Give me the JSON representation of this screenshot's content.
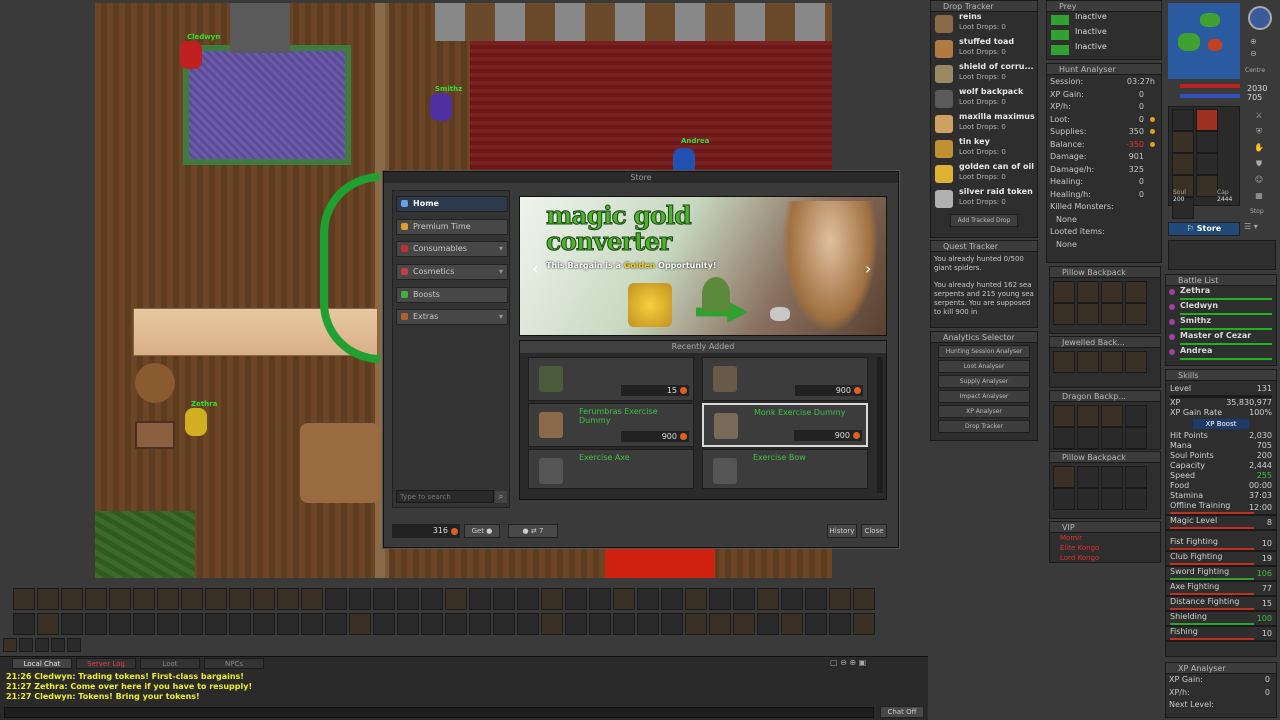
{
  "map": {
    "characters": [
      {
        "name": "Cledwyn"
      },
      {
        "name": "Smithz"
      },
      {
        "name": "Andrea"
      },
      {
        "name": "Zethra"
      }
    ]
  },
  "store": {
    "title": "Store",
    "categories": [
      {
        "label": "Home",
        "has_arrow": false
      },
      {
        "label": "Premium Time",
        "has_arrow": false
      },
      {
        "label": "Consumables",
        "has_arrow": true
      },
      {
        "label": "Cosmetics",
        "has_arrow": true
      },
      {
        "label": "Boosts",
        "has_arrow": false
      },
      {
        "label": "Extras",
        "has_arrow": true
      }
    ],
    "search_placeholder": "Type to search",
    "banner": {
      "title_line1": "magic gold",
      "title_line2": "converter",
      "subtitle_pre": "This Bargain is a ",
      "subtitle_highlight": "Golden",
      "subtitle_post": " Opportunity!"
    },
    "recently_added_label": "Recently Added",
    "items": [
      {
        "name": "",
        "price": "15"
      },
      {
        "name": "",
        "price": "900"
      },
      {
        "name": "Ferumbras Exercise Dummy",
        "price": "900"
      },
      {
        "name": "Monk Exercise Dummy",
        "price": "900"
      },
      {
        "name": "Exercise Axe",
        "price": ""
      },
      {
        "name": "Exercise Bow",
        "price": ""
      }
    ],
    "coins": "316",
    "get_label": "Get",
    "transfer_value": "7",
    "history_label": "History",
    "close_label": "Close"
  },
  "drop_tracker": {
    "title": "Drop Tracker",
    "items": [
      {
        "name": "reins",
        "drops": "Loot Drops: 0"
      },
      {
        "name": "stuffed toad",
        "drops": "Loot Drops: 0"
      },
      {
        "name": "shield of corru...",
        "drops": "Loot Drops: 0"
      },
      {
        "name": "wolf backpack",
        "drops": "Loot Drops: 0"
      },
      {
        "name": "maxilla maximus",
        "drops": "Loot Drops: 0"
      },
      {
        "name": "tin key",
        "drops": "Loot Drops: 0"
      },
      {
        "name": "golden can of oil",
        "drops": "Loot Drops: 0"
      },
      {
        "name": "silver raid token",
        "drops": "Loot Drops: 0"
      }
    ],
    "add_label": "Add Tracked Drop"
  },
  "quest_tracker": {
    "title": "Quest Tracker",
    "lines": [
      "You already hunted 0/500 giant spiders.",
      "You already hunted 162 sea serpents and 215 young sea serpents. You are supposed to kill 900 in"
    ]
  },
  "analytics": {
    "title": "Analytics Selector",
    "buttons": [
      "Hunting Session Analyser",
      "Loot Analyser",
      "Supply Analyser",
      "Impact Analyser",
      "XP Analyser",
      "Drop Tracker"
    ]
  },
  "prey": {
    "title": "Prey",
    "slots": [
      "Inactive",
      "Inactive",
      "Inactive"
    ]
  },
  "hunt_analyser": {
    "title": "Hunt Analyser",
    "rows": [
      {
        "k": "Session:",
        "v": "03:27h"
      },
      {
        "k": "XP Gain:",
        "v": "0"
      },
      {
        "k": "XP/h:",
        "v": "0"
      },
      {
        "k": "Loot:",
        "v": "0"
      },
      {
        "k": "Supplies:",
        "v": "350"
      },
      {
        "k": "Balance:",
        "v": "-350"
      },
      {
        "k": "Damage:",
        "v": "901"
      },
      {
        "k": "Damage/h:",
        "v": "325"
      },
      {
        "k": "Healing:",
        "v": "0"
      },
      {
        "k": "Healing/h:",
        "v": "0"
      }
    ],
    "killed_label": "Killed Monsters:",
    "killed_value": "None",
    "looted_label": "Looted items:",
    "looted_value": "None"
  },
  "containers": [
    {
      "title": "Pillow Backpack"
    },
    {
      "title": "Jewelled Back..."
    },
    {
      "title": "Dragon Backp..."
    },
    {
      "title": "Pillow Backpack"
    }
  ],
  "vip": {
    "title": "VIP",
    "names": [
      "Momir",
      "Elite Kongo",
      "Lord Kongo"
    ]
  },
  "status": {
    "hp": "2030",
    "mana": "705",
    "soul": "200",
    "cap": "2444",
    "soul_label": "Soul",
    "cap_label": "Cap",
    "store_label": "Store",
    "stop_label": "Stop",
    "centre_label": "Centre"
  },
  "battle_list": {
    "title": "Battle List",
    "names": [
      "Zethra",
      "Cledwyn",
      "Smithz",
      "Master of Cezar",
      "Andrea"
    ]
  },
  "skills": {
    "title": "Skills",
    "level_label": "Level",
    "level": "131",
    "xp_label": "XP",
    "xp": "35,830,977",
    "xp_rate_label": "XP Gain Rate",
    "xp_rate": "100%",
    "xp_boost_label": "XP Boost",
    "stats": [
      {
        "k": "Hit Points",
        "v": "2,030"
      },
      {
        "k": "Mana",
        "v": "705"
      },
      {
        "k": "Soul Points",
        "v": "200"
      },
      {
        "k": "Capacity",
        "v": "2,444"
      },
      {
        "k": "Speed",
        "v": "255"
      },
      {
        "k": "Food",
        "v": "00:00"
      },
      {
        "k": "Stamina",
        "v": "37:03"
      }
    ],
    "offline_label": "Offline Training",
    "offline": "12:00",
    "magic_label": "Magic Level",
    "magic": "8",
    "fighting": [
      {
        "k": "Fist Fighting",
        "v": "10"
      },
      {
        "k": "Club Fighting",
        "v": "19"
      },
      {
        "k": "Sword Fighting",
        "v": "106"
      },
      {
        "k": "Axe Fighting",
        "v": "77"
      },
      {
        "k": "Distance Fighting",
        "v": "15"
      },
      {
        "k": "Shielding",
        "v": "100"
      },
      {
        "k": "Fishing",
        "v": "10"
      }
    ]
  },
  "xp_analyser": {
    "title": "XP Analyser",
    "rows": [
      {
        "k": "XP Gain:",
        "v": "0"
      },
      {
        "k": "XP/h:",
        "v": "0"
      },
      {
        "k": "Next Level:",
        "v": ""
      }
    ]
  },
  "chat": {
    "tabs": [
      "Local Chat",
      "Server Log",
      "Loot",
      "NPCs"
    ],
    "lines": [
      "21:26 Cledwyn: Trading tokens! First-class bargains!",
      "21:27 Zethra: Come over here if you have to resupply!",
      "21:27 Cledwyn: Tokens! Bring your tokens!"
    ],
    "chat_off_label": "Chat Off"
  },
  "colors": {
    "accent_green": "#40c040",
    "name_green": "#30e030",
    "chat_yellow": "#f0f020",
    "vip_red": "#e03030",
    "store_active": "#2c3a4c"
  }
}
